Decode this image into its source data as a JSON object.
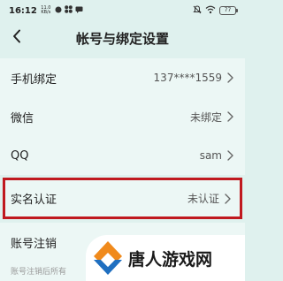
{
  "status_bar": {
    "time": "16:12",
    "net_speed_top": "11.0",
    "net_speed_bottom": "KB/s",
    "battery": "77"
  },
  "header": {
    "title": "帐号与绑定设置"
  },
  "rows": [
    {
      "label": "手机绑定",
      "value": "137****1559"
    },
    {
      "label": "微信",
      "value": "未绑定"
    },
    {
      "label": "QQ",
      "value": "sam"
    }
  ],
  "verify": {
    "label": "实名认证",
    "value": "未认证"
  },
  "cancel": {
    "label": "账号注销",
    "description": "账号注销后所有"
  },
  "watermark": {
    "text": "唐人游戏网"
  },
  "colors": {
    "background": "#dff1ee",
    "highlight_border": "#c0191f",
    "logo_orange": "#f08a1c",
    "logo_blue": "#1f6fc0"
  }
}
